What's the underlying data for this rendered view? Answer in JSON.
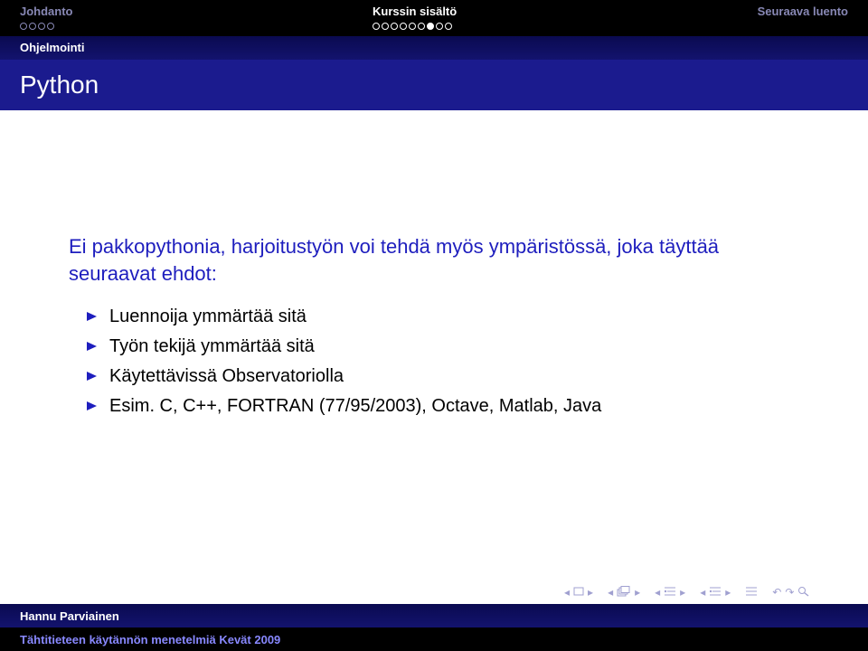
{
  "nav": {
    "sections": [
      {
        "label": "Johdanto",
        "dots": 4,
        "filled_index": -1,
        "active": false
      },
      {
        "label": "Kurssin sisältö",
        "dots": 9,
        "filled_index": 6,
        "active": true
      },
      {
        "label": "Seuraava luento",
        "dots": 0,
        "filled_index": -1,
        "active": false
      }
    ],
    "subsection": "Ohjelmointi"
  },
  "frame": {
    "title": "Python",
    "intro": "Ei pakkopythonia, harjoitustyön voi tehdä myös ympäristössä, joka täyttää seuraavat ehdot:",
    "bullets": [
      "Luennoija ymmärtää sitä",
      "Työn tekijä ymmärtää sitä",
      "Käytettävissä Observatoriolla",
      "Esim. C, C++, FORTRAN (77/95/2003), Octave, Matlab, Java"
    ]
  },
  "navigation_symbols": [
    "nav-first-icon",
    "slide-icon",
    "nav-next-icon",
    "nav-prev-icon",
    "frame-icon",
    "nav-next-icon",
    "nav-prev-icon",
    "subsection-icon",
    "nav-next-icon",
    "nav-prev-icon",
    "section-icon",
    "nav-next-icon",
    "align-icon",
    "undo-icon",
    "redo-icon",
    "search-icon"
  ],
  "footer": {
    "author": "Hannu Parviainen",
    "course": "Tähtitieteen käytännön menetelmiä Kevät 2009"
  },
  "colors": {
    "title_bar": "#1b1b8e",
    "accent_text": "#1e1ebe",
    "nav_bar": "#000000",
    "nav_inactive": "#8888b5"
  }
}
